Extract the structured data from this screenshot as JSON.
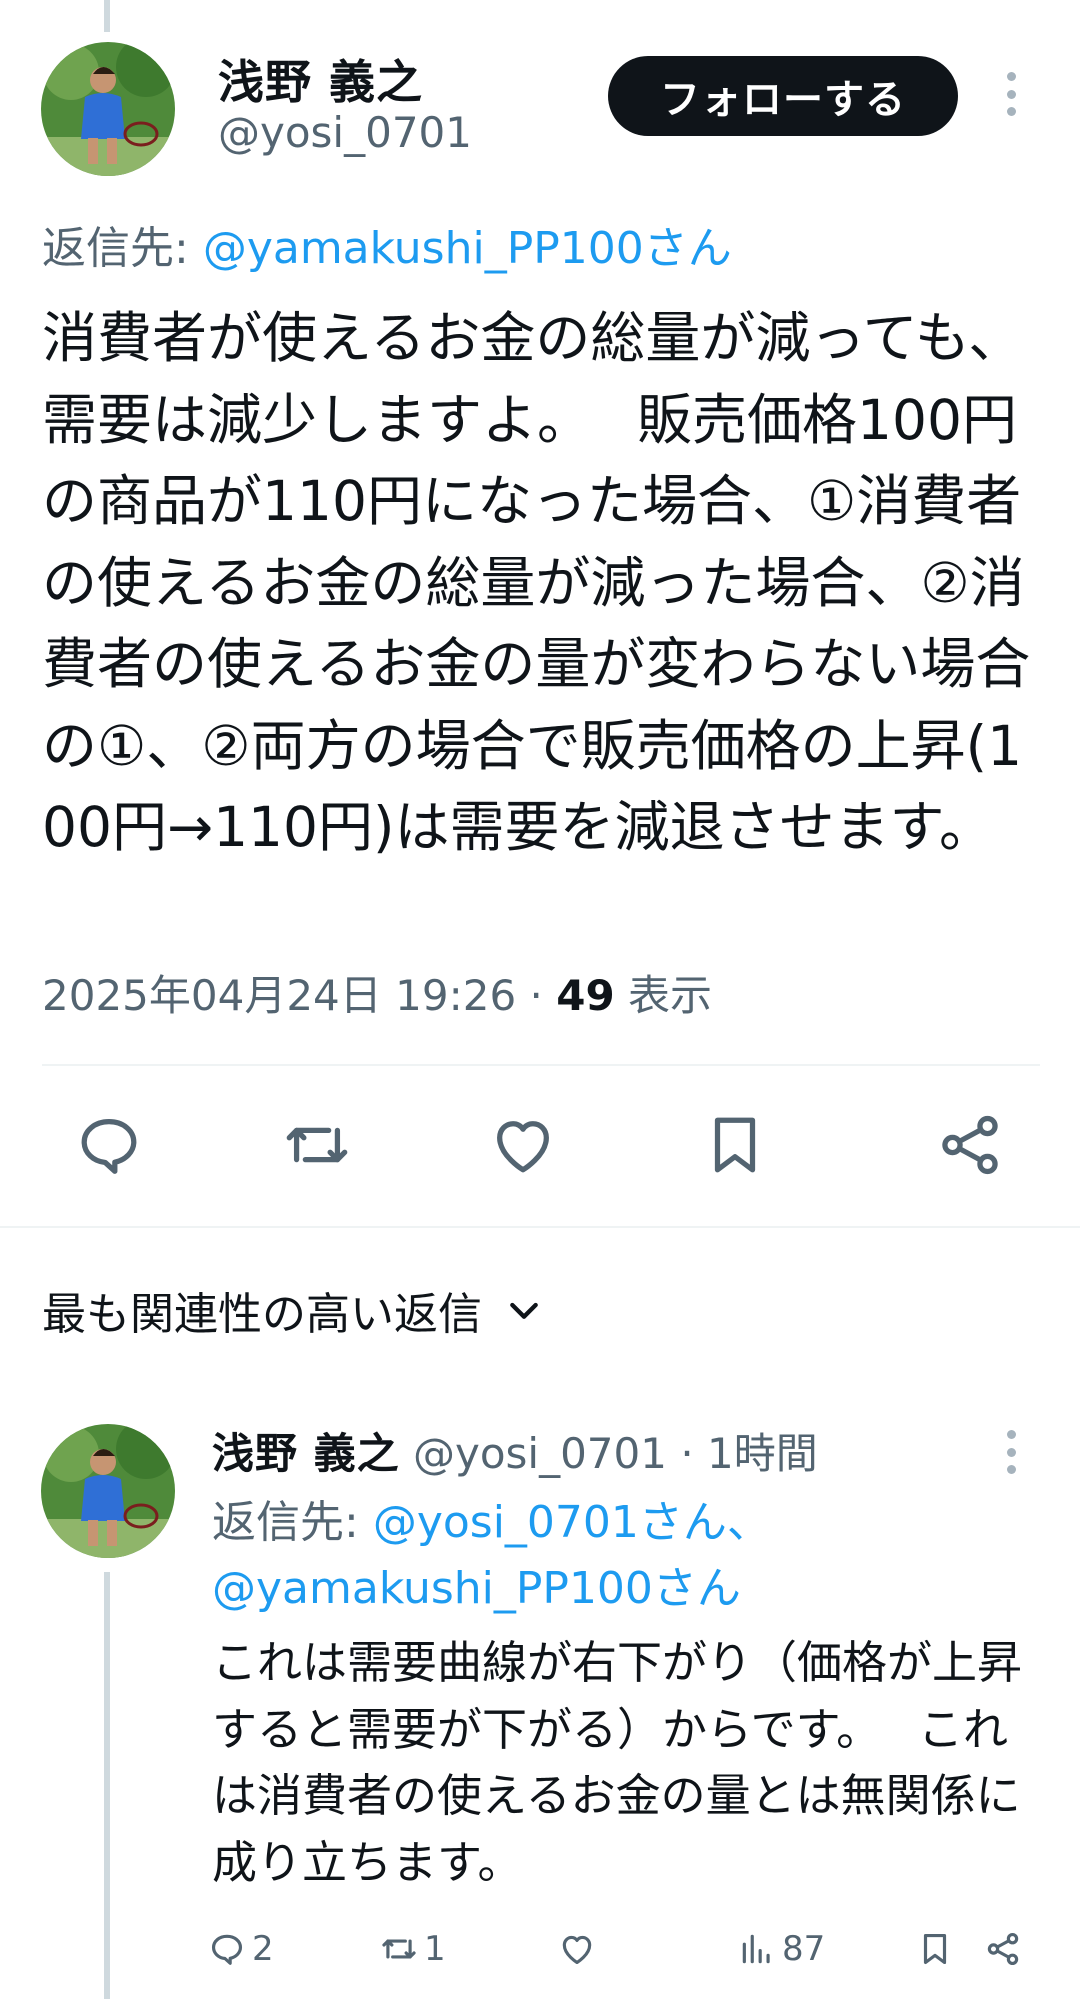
{
  "tweet": {
    "author_name": "浅野 義之",
    "author_handle": "@yosi_0701",
    "follow_label": "フォローする",
    "reply_prefix": "返信先: ",
    "reply_mention": "@yamakushi_PP100さん",
    "text": "消費者が使えるお金の総量が減っても、需要は減少しますよ。　 販売価格100円の商品が110円になった場合、①消費者の使えるお金の総量が減った場合、②消費者の使えるお金の量が変わらない場合の①、②両方の場合で販売価格の上昇(100円→110円)は需要を減退させます。",
    "timestamp": "2025年04月24日 19:26",
    "separator": " · ",
    "views_count": "49",
    "views_label": " 表示"
  },
  "actions": {
    "reply_icon": "reply-icon",
    "retweet_icon": "retweet-icon",
    "like_icon": "like-icon",
    "bookmark_icon": "bookmark-icon",
    "share_icon": "share-icon"
  },
  "sort": {
    "label": "最も関連性の高い返信"
  },
  "reply": {
    "author_name": "浅野 義之",
    "author_handle": " @yosi_0701",
    "time": " · 1時間",
    "reply_prefix": "返信先: ",
    "reply_mention_1": "@yosi_0701さん、",
    "reply_mention_2": "@yamakushi_PP100さん",
    "text": "これは需要曲線が右下がり（価格が上昇すると需要が下がる）からです。　 これは消費者の使えるお金の量とは無関係に成り立ちます。",
    "reply_count": "2",
    "retweet_count": "1",
    "views_count": "87"
  },
  "colors": {
    "accent": "#1d9bf0",
    "text_primary": "#0f1419",
    "text_secondary": "#536471",
    "thread_line": "#cfd9de"
  }
}
